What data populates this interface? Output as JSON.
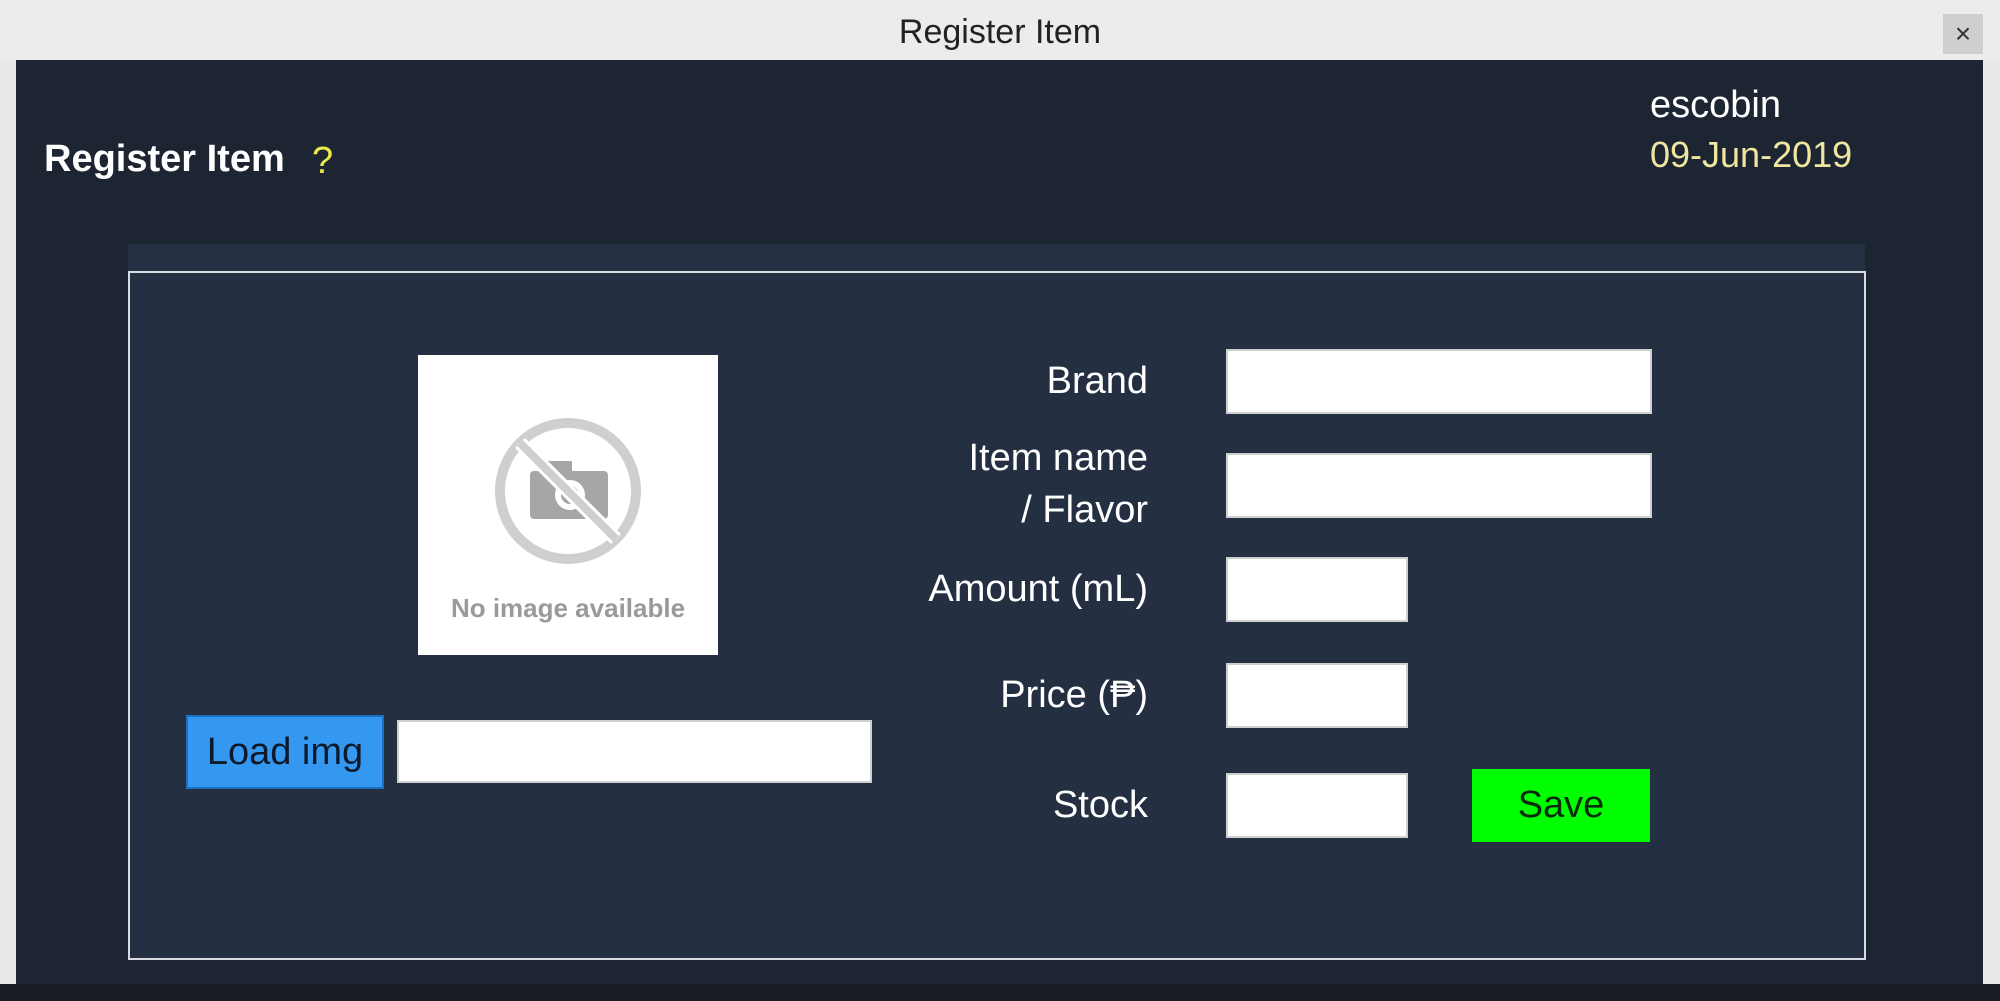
{
  "window": {
    "title": "Register Item",
    "close_label": "×"
  },
  "header": {
    "heading": "Register Item",
    "help_label": "?",
    "username": "escobin",
    "date": "09-Jun-2019"
  },
  "image_panel": {
    "placeholder_text": "No image available",
    "load_button_label": "Load img",
    "path_value": ""
  },
  "form": {
    "brand_label": "Brand",
    "item_name_label_line1": "Item name",
    "item_name_label_line2": "/ Flavor",
    "amount_label": "Amount (mL)",
    "price_label": "Price (₱)",
    "stock_label": "Stock",
    "brand_value": "",
    "item_name_value": "",
    "amount_value": "",
    "price_value": "",
    "stock_value": "",
    "save_label": "Save"
  }
}
